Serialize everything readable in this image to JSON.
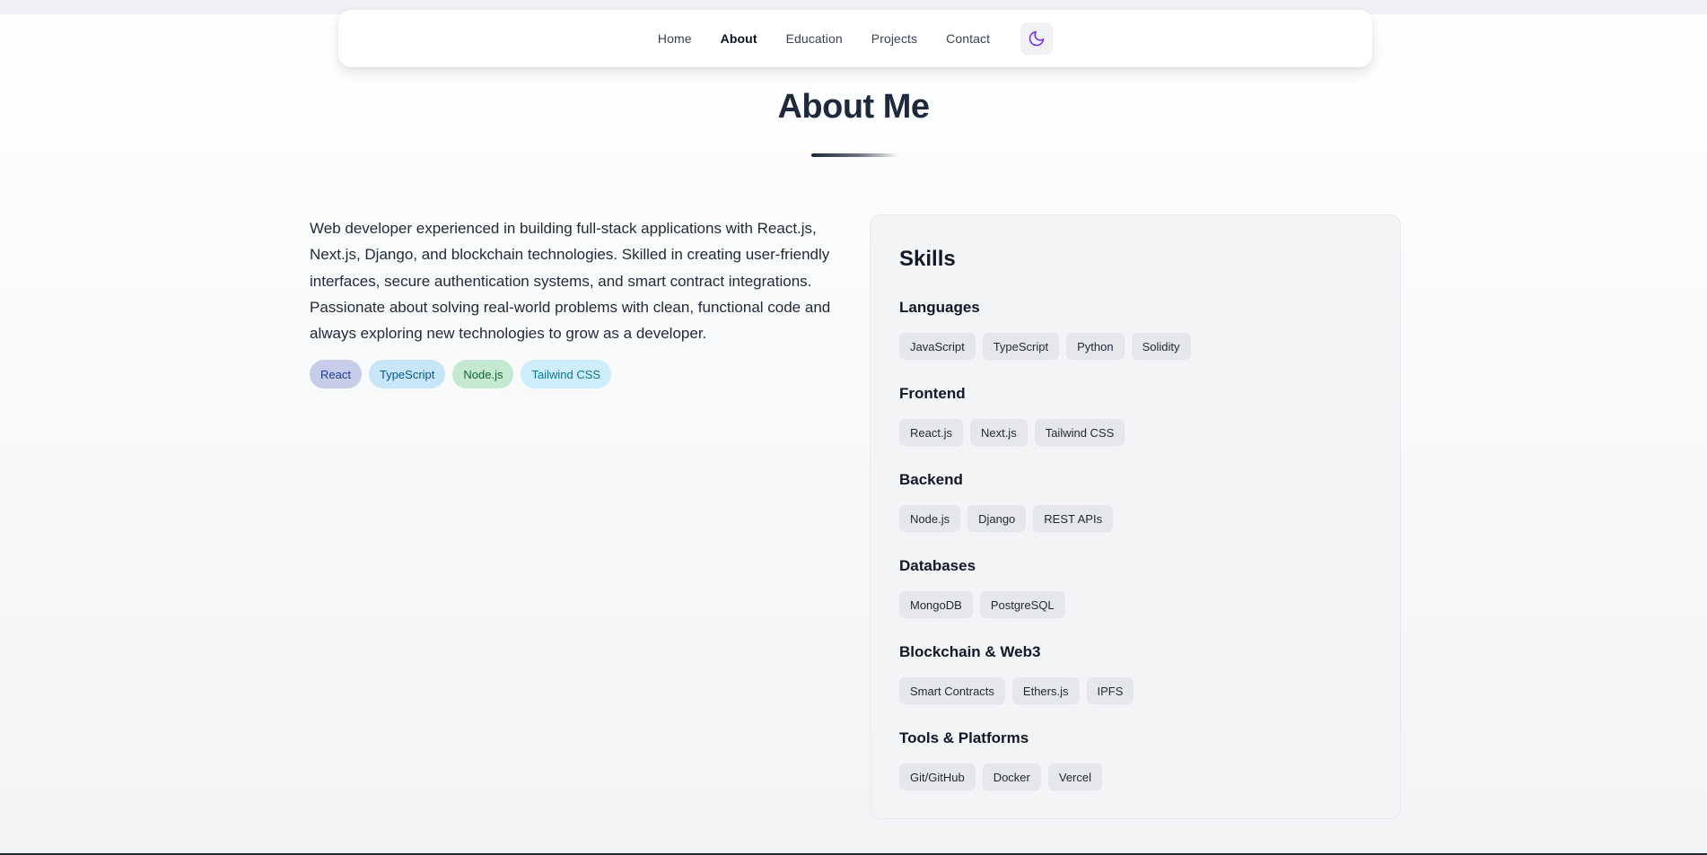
{
  "nav": {
    "links": [
      "Home",
      "About",
      "Education",
      "Projects",
      "Contact"
    ],
    "active": "About",
    "theme_icon": "moon-icon",
    "accent_color": "#7c3aed"
  },
  "page": {
    "title": "About Me"
  },
  "about": {
    "text": "Web developer experienced in building full-stack applications with React.js, Next.js, Django, and blockchain technologies. Skilled in creating user-friendly interfaces, secure authentication systems, and smart contract integrations. Passionate about solving real-world problems with clean, functional code and always exploring new technologies to grow as a developer.",
    "tags": [
      "React",
      "TypeScript",
      "Node.js",
      "Tailwind CSS"
    ]
  },
  "skills": {
    "title": "Skills",
    "groups": [
      {
        "title": "Languages",
        "items": [
          "JavaScript",
          "TypeScript",
          "Python",
          "Solidity"
        ]
      },
      {
        "title": "Frontend",
        "items": [
          "React.js",
          "Next.js",
          "Tailwind CSS"
        ]
      },
      {
        "title": "Backend",
        "items": [
          "Node.js",
          "Django",
          "REST APIs"
        ]
      },
      {
        "title": "Databases",
        "items": [
          "MongoDB",
          "PostgreSQL"
        ]
      },
      {
        "title": "Blockchain & Web3",
        "items": [
          "Smart Contracts",
          "Ethers.js",
          "IPFS"
        ]
      },
      {
        "title": "Tools & Platforms",
        "items": [
          "Git/GitHub",
          "Docker",
          "Vercel"
        ]
      }
    ]
  }
}
